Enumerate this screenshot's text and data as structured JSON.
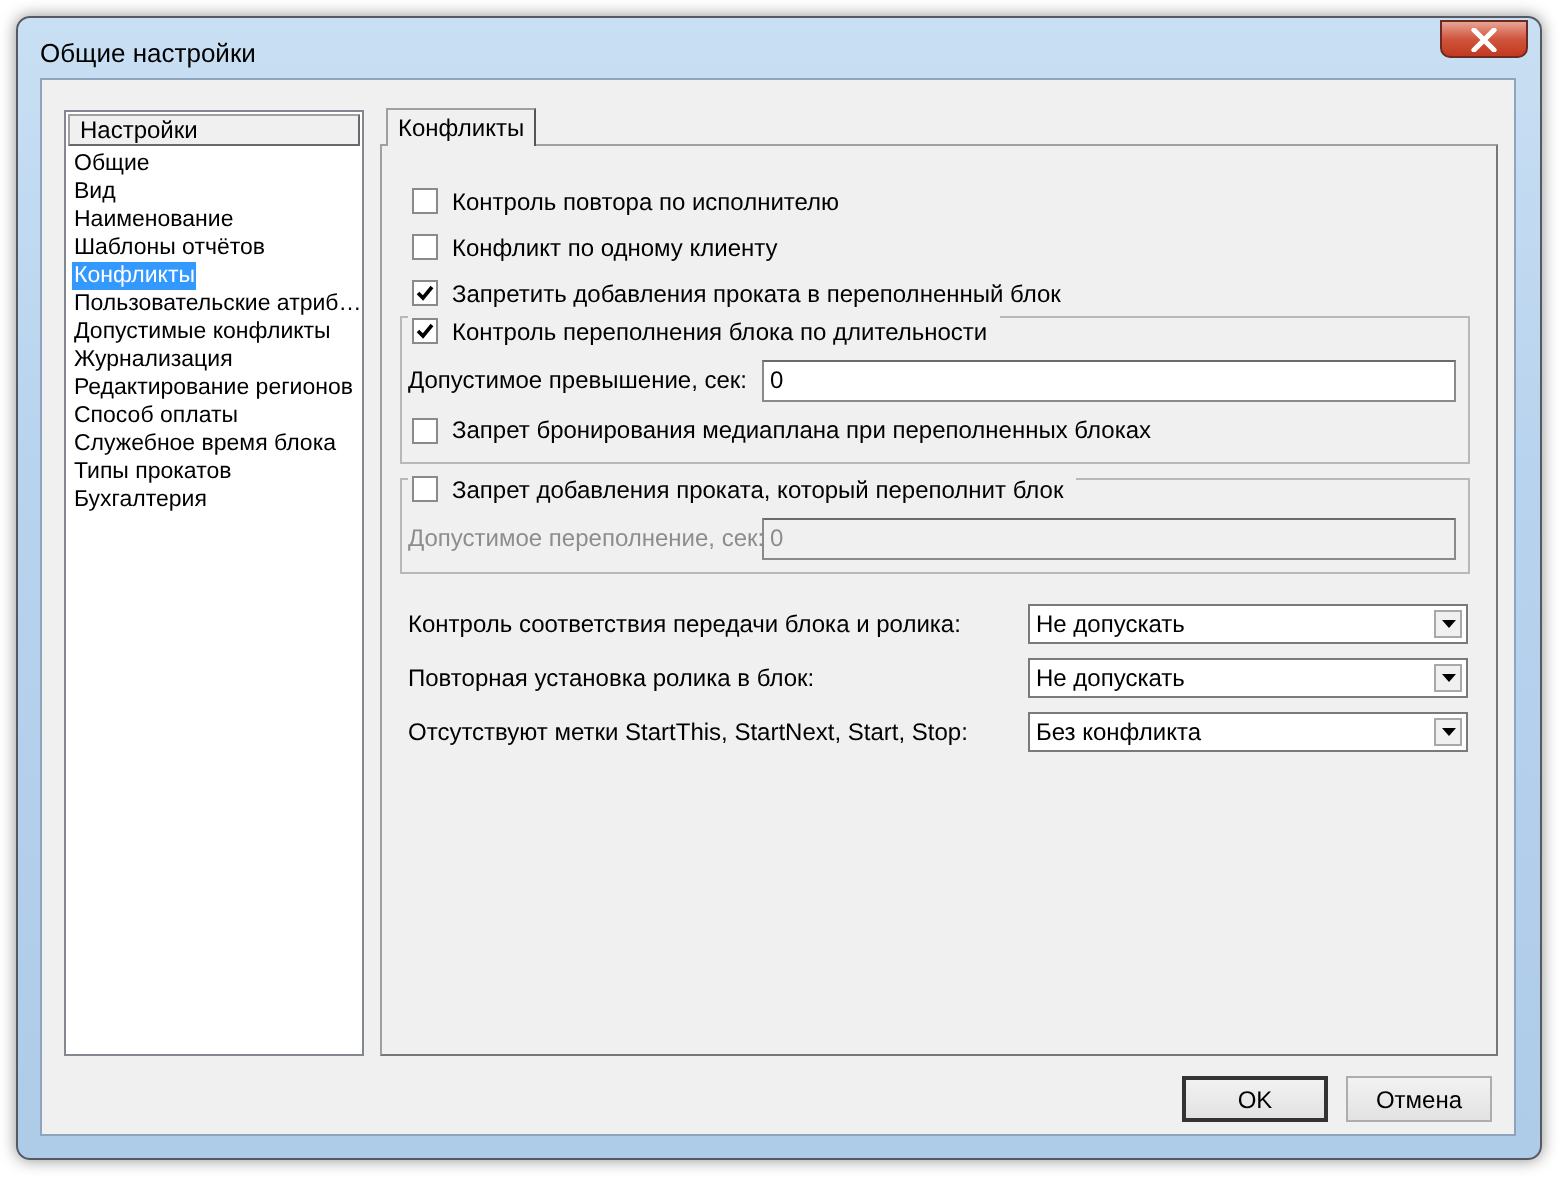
{
  "window": {
    "title": "Общие настройки"
  },
  "sidebar": {
    "header": "Настройки",
    "items": [
      {
        "label": "Общие",
        "selected": false
      },
      {
        "label": "Вид",
        "selected": false
      },
      {
        "label": "Наименование",
        "selected": false
      },
      {
        "label": "Шаблоны отчётов",
        "selected": false
      },
      {
        "label": "Конфликты",
        "selected": true
      },
      {
        "label": "Пользовательские атриб…",
        "selected": false
      },
      {
        "label": "Допустимые конфликты",
        "selected": false
      },
      {
        "label": "Журнализация",
        "selected": false
      },
      {
        "label": "Редактирование регионов",
        "selected": false
      },
      {
        "label": "Способ оплаты",
        "selected": false
      },
      {
        "label": "Служебное время блока",
        "selected": false
      },
      {
        "label": "Типы прокатов",
        "selected": false
      },
      {
        "label": "Бухгалтерия",
        "selected": false
      }
    ]
  },
  "tabs": [
    {
      "label": "Конфликты",
      "selected": true
    }
  ],
  "settings": [
    {
      "kind": "checkbox",
      "label": "Контроль повтора по исполнителю",
      "checked": false
    },
    {
      "kind": "checkbox",
      "label": "Конфликт по одному клиенту",
      "checked": false
    },
    {
      "kind": "checkbox",
      "label": "Запретить добавления проката в переполненный блок",
      "checked": true
    },
    {
      "kind": "group",
      "label": "Контроль переполнения блока по длительности",
      "checked": true,
      "rows": [
        {
          "kind": "field",
          "label": "Допустимое превышение, сек:",
          "value": "0",
          "disabled": false
        },
        {
          "kind": "checkbox",
          "label": "Запрет бронирования медиаплана при переполненных блоках",
          "checked": false
        }
      ]
    },
    {
      "kind": "group",
      "label": "Запрет добавления проката, который переполнит блок",
      "checked": false,
      "rows": [
        {
          "kind": "field",
          "label": "Допустимое переполнение, сек:",
          "value": "0",
          "disabled": true
        }
      ]
    }
  ],
  "dropdowns": [
    {
      "label": "Контроль соответствия передачи блока и ролика:",
      "value": "Не допускать"
    },
    {
      "label": "Повторная установка ролика в блок:",
      "value": "Не допускать"
    },
    {
      "label": "Отсутствуют метки StartThis, StartNext, Start, Stop:",
      "value": "Без конфликта"
    }
  ],
  "buttons": [
    {
      "label": "OK",
      "default": true
    },
    {
      "label": "Отмена",
      "default": false
    }
  ]
}
